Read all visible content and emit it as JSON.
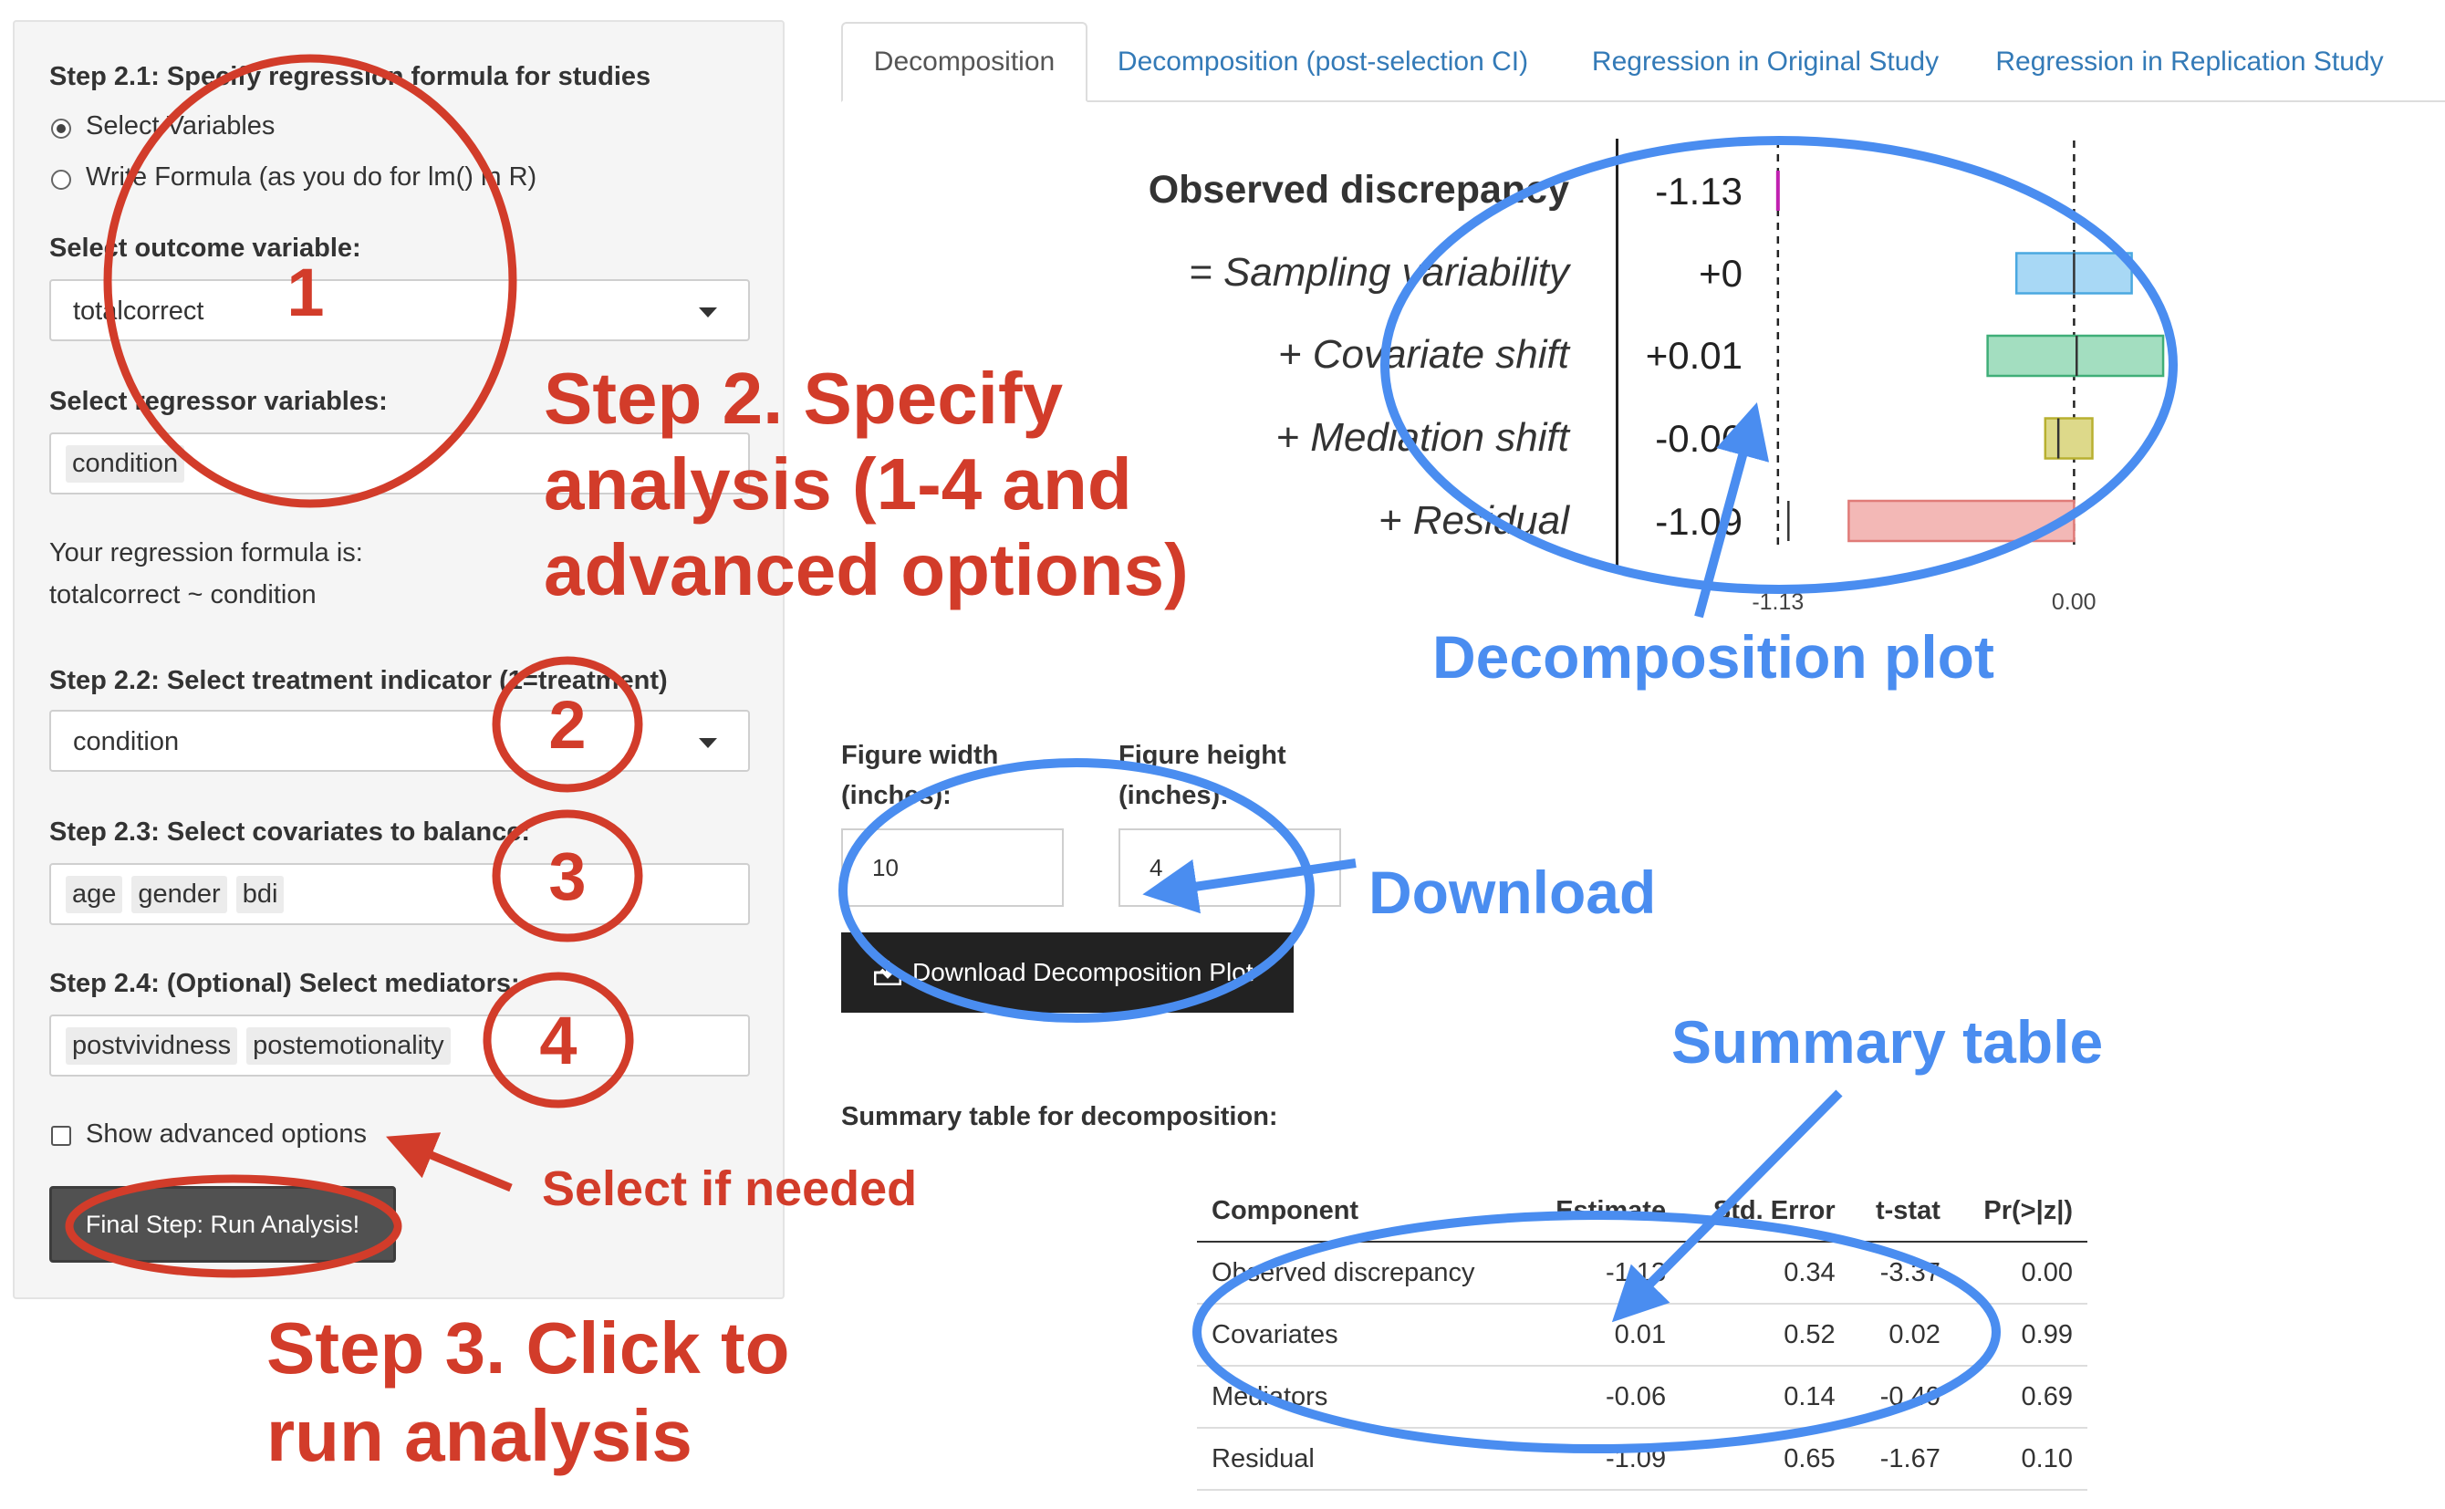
{
  "sidebar": {
    "step21_label": "Step 2.1: Specify regression formula for studies",
    "radio_options": [
      "Select Variables",
      "Write Formula (as you do for lm() in R)"
    ],
    "outcome_label": "Select outcome variable:",
    "outcome_value": "totalcorrect",
    "regressor_label": "Select regressor variables:",
    "regressor_chips": [
      "condition"
    ],
    "formula_label": "Your regression formula is:",
    "formula_value": "totalcorrect ~ condition",
    "step22_label": "Step 2.2: Select treatment indicator (1=treatment)",
    "treatment_value": "condition",
    "step23_label": "Step 2.3: Select covariates to balance:",
    "covariate_chips": [
      "age",
      "gender",
      "bdi"
    ],
    "step24_label": "Step 2.4: (Optional) Select mediators:",
    "mediator_chips": [
      "postvividness",
      "postemotionality"
    ],
    "advanced_label": "Show advanced options",
    "run_button": "Final Step: Run Analysis!"
  },
  "tabs": [
    "Decomposition",
    "Decomposition (post-selection CI)",
    "Regression in Original Study",
    "Regression in Replication Study"
  ],
  "chart_data": {
    "type": "bar",
    "orientation": "horizontal",
    "categories": [
      "Observed discrepancy",
      "= Sampling variability",
      "+ Covariate shift",
      "+ Mediation shift",
      "+ Residual"
    ],
    "values": [
      -1.13,
      0,
      0.01,
      -0.06,
      -1.09
    ],
    "value_labels": [
      "-1.13",
      "+0",
      "+0.01",
      "-0.06",
      "-1.09"
    ],
    "intervals": [
      [
        -1.13,
        -1.13
      ],
      [
        -0.22,
        0.22
      ],
      [
        -0.33,
        0.34
      ],
      [
        -0.11,
        0.07
      ],
      [
        -0.86,
        0
      ]
    ],
    "colors": [
      "#e040c8",
      "#a8d8f5",
      "#a3dec0",
      "#ddd98a",
      "#f3b8b6"
    ],
    "border_colors": [
      "#c020b0",
      "#4aa8e0",
      "#3fae78",
      "#b8b030",
      "#e07b78"
    ],
    "x_ticks": [
      "-1.13",
      "0.00"
    ],
    "reference_lines": [
      -1.13,
      0
    ],
    "xlim": [
      -1.3,
      0.58
    ]
  },
  "download": {
    "width_label": "Figure width\n(inches):",
    "width_value": "10",
    "height_label": "Figure height\n(inches):",
    "height_value": "4",
    "button_label": "Download Decomposition Plot"
  },
  "summary": {
    "title": "Summary table for decomposition:",
    "columns": [
      "Component",
      "Estimate",
      "Std. Error",
      "t-stat",
      "Pr(>|z|)"
    ],
    "rows": [
      [
        "Observed discrepancy",
        "-1.13",
        "0.34",
        "-3.37",
        "0.00"
      ],
      [
        "Covariates",
        "0.01",
        "0.52",
        "0.02",
        "0.99"
      ],
      [
        "Mediators",
        "-0.06",
        "0.14",
        "-0.40",
        "0.69"
      ],
      [
        "Residual",
        "-1.09",
        "0.65",
        "-1.67",
        "0.10"
      ]
    ]
  },
  "annotations": {
    "num1": "1",
    "num2": "2",
    "num3": "3",
    "num4": "4",
    "step2_line1": "Step 2. Specify",
    "step2_line2": "analysis (1-4 and",
    "step2_line3": "advanced options)",
    "select_if_needed": "Select if needed",
    "step3_line1": "Step 3. Click to",
    "step3_line2": "run analysis",
    "decomposition_plot": "Decomposition plot",
    "download": "Download",
    "summary_table": "Summary table",
    "red": "#d23c2a",
    "blue": "#4a8df0"
  }
}
